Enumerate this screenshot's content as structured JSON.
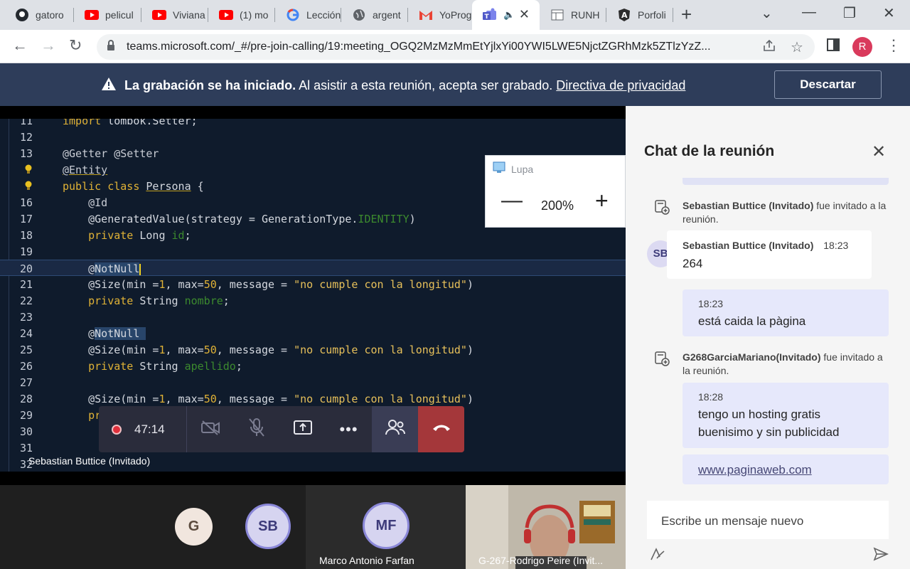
{
  "browser": {
    "tabs": [
      {
        "label": "gatoro",
        "icon": "github-icon"
      },
      {
        "label": "pelicul",
        "icon": "youtube-icon"
      },
      {
        "label": "Viviana",
        "icon": "youtube-icon"
      },
      {
        "label": "(1) mo",
        "icon": "youtube-icon"
      },
      {
        "label": "Lección",
        "icon": "google-icon"
      },
      {
        "label": "argent",
        "icon": "globe-icon"
      },
      {
        "label": "YoProg",
        "icon": "gmail-icon"
      },
      {
        "label": "",
        "icon": "teams-icon",
        "active": true
      },
      {
        "label": "RUNH",
        "icon": "table-icon"
      },
      {
        "label": "Porfoli",
        "icon": "angular-icon"
      }
    ],
    "url": "teams.microsoft.com/_#/pre-join-calling/19:meeting_OGQ2MzMzMmEtYjlxYi00YWI5LWE5NjctZGRhMzk5ZTlzYzZ...",
    "profile_initial": "R"
  },
  "banner": {
    "bold": "La grabación se ha iniciado.",
    "text": " Al asistir a esta reunión, acepta ser grabado. ",
    "link": "Directiva de privacidad",
    "dismiss": "Descartar"
  },
  "code": {
    "lines": [
      {
        "n": "11",
        "text": "import lombok.Setter;"
      },
      {
        "n": "12",
        "text": ""
      },
      {
        "n": "13",
        "text": "@Getter @Setter"
      },
      {
        "n": "",
        "text": "@Entity"
      },
      {
        "n": "",
        "text": "public class Persona {"
      },
      {
        "n": "16",
        "text": "    @Id"
      },
      {
        "n": "17",
        "text": "    @GeneratedValue(strategy = GenerationType.IDENTITY)"
      },
      {
        "n": "18",
        "text": "    private Long id;"
      },
      {
        "n": "19",
        "text": ""
      },
      {
        "n": "20",
        "text": "    @NotNull"
      },
      {
        "n": "21",
        "text": "    @Size(min =1, max=50, message = \"no cumple con la longitud\")"
      },
      {
        "n": "22",
        "text": "    private String nombre;"
      },
      {
        "n": "23",
        "text": ""
      },
      {
        "n": "24",
        "text": "    @NotNull"
      },
      {
        "n": "25",
        "text": "    @Size(min =1, max=50, message = \"no cumple con la longitud\")"
      },
      {
        "n": "26",
        "text": "    private String apellido;"
      },
      {
        "n": "27",
        "text": ""
      },
      {
        "n": "28",
        "text": "    @Size(min =1, max=50, message = \"no cumple con la longitud\")"
      },
      {
        "n": "29",
        "text": "    private String"
      },
      {
        "n": "30",
        "text": ""
      },
      {
        "n": "31",
        "text": ""
      },
      {
        "n": "32",
        "text": ""
      }
    ]
  },
  "stage": {
    "speaker": "Sebastian Buttice (Invitado)"
  },
  "magnifier": {
    "title": "Lupa",
    "zoom": "200%"
  },
  "controls": {
    "timer": "47:14"
  },
  "participants": [
    {
      "initials": "G",
      "name": ""
    },
    {
      "initials": "SB",
      "name": ""
    },
    {
      "initials": "MF",
      "name": "Marco Antonio Farfan"
    },
    {
      "initials": "",
      "name": "G-267-Rodrigo Peire (Invit..."
    }
  ],
  "chat": {
    "title": "Chat de la reunión",
    "events": [
      {
        "name": "Sebastian Buttice (Invitado)",
        "text": " fue invitado a la reunión."
      },
      {
        "name": "G268GarciaMariano(Invitado)",
        "text": " fue invitado a la reunión."
      }
    ],
    "incoming": {
      "avatar": "SB",
      "author": "Sebastian Buttice (Invitado)",
      "time": "18:23",
      "body": "264"
    },
    "outgoing": [
      {
        "time": "18:23",
        "body": "está caida la pàgina"
      },
      {
        "time": "18:28",
        "body": "tengo un hosting gratis buenisimo y sin publicidad"
      },
      {
        "time": "",
        "body": "www.paginaweb.com"
      }
    ],
    "compose_placeholder": "Escribe un mensaje nuevo"
  }
}
